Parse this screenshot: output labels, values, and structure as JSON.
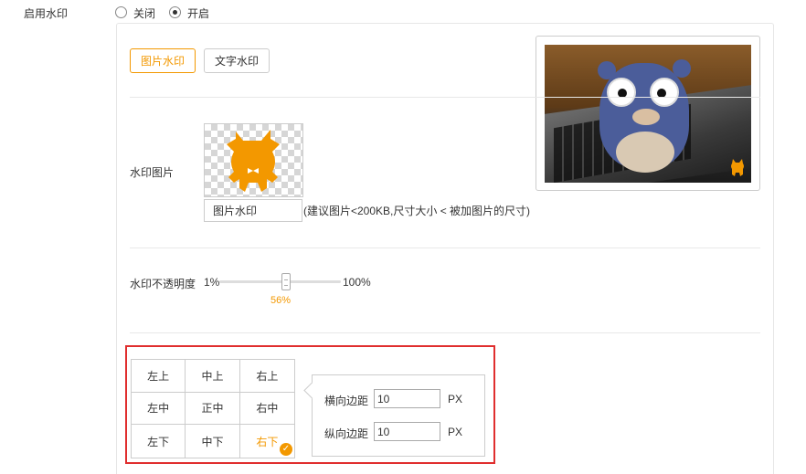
{
  "enable": {
    "label": "启用水印",
    "options": [
      {
        "label": "关闭",
        "selected": false
      },
      {
        "label": "开启",
        "selected": true
      }
    ]
  },
  "tabs": [
    {
      "label": "图片水印",
      "active": true
    },
    {
      "label": "文字水印",
      "active": false
    }
  ],
  "watermark_image": {
    "label": "水印图片",
    "button_label": "图片水印",
    "hint": "(建议图片<200KB,尺寸大小 < 被加图片的尺寸)"
  },
  "opacity": {
    "label": "水印不透明度",
    "min_label": "1%",
    "max_label": "100%",
    "value": 56,
    "value_label": "56%"
  },
  "position": {
    "cells": [
      "左上",
      "中上",
      "右上",
      "左中",
      "正中",
      "右中",
      "左下",
      "中下",
      "右下"
    ],
    "selected": "右下"
  },
  "margins": {
    "horizontal_label": "横向边距",
    "horizontal_value": "10",
    "vertical_label": "纵向边距",
    "vertical_value": "10",
    "unit": "PX"
  },
  "colors": {
    "accent": "#f39800",
    "highlight_border": "#e02e2e"
  }
}
